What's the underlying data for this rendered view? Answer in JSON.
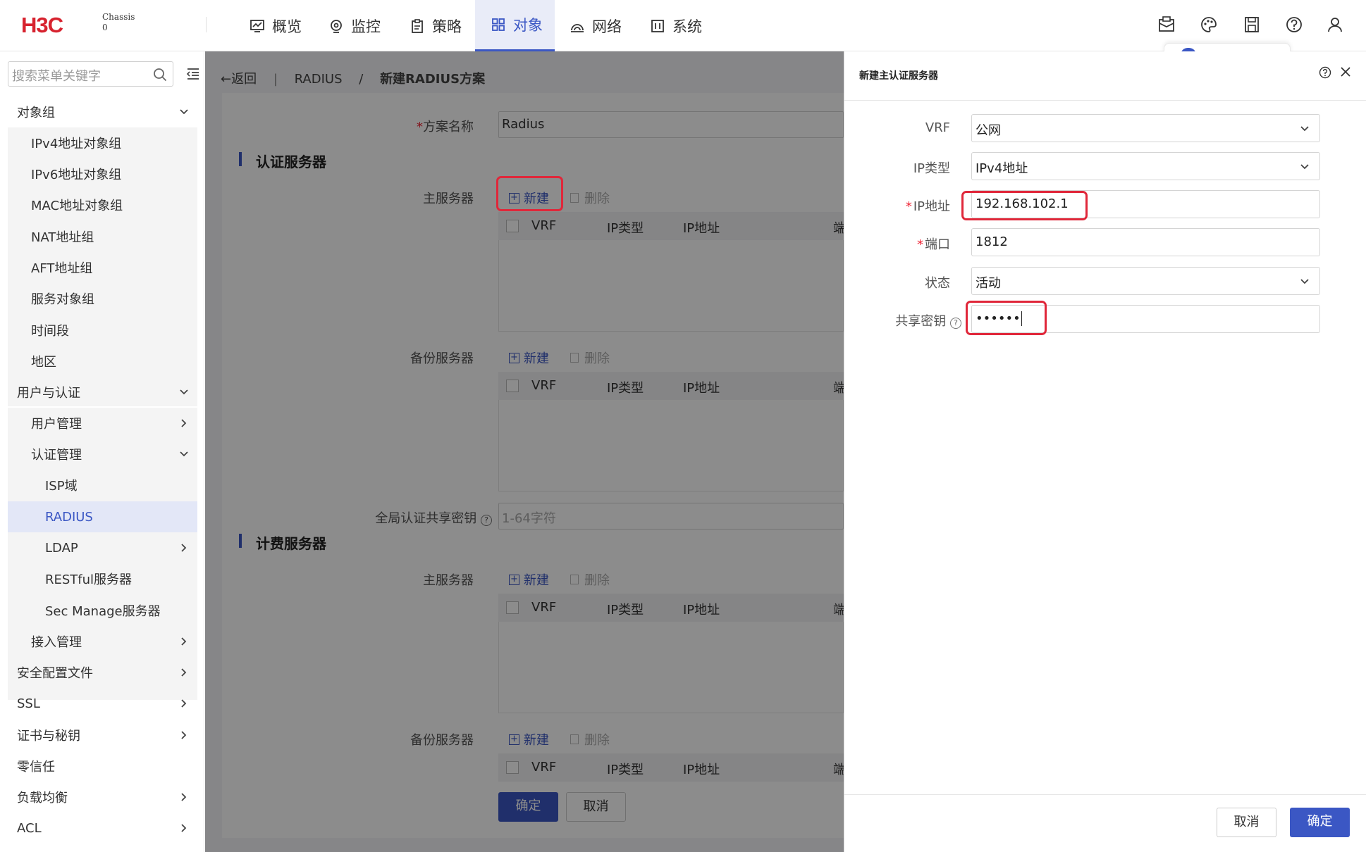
{
  "brand": {
    "logo": "H3C",
    "device_line1": "Chassis",
    "device_line2": "0"
  },
  "nav": [
    {
      "label": "概览",
      "icon": "dashboard-icon"
    },
    {
      "label": "监控",
      "icon": "monitor-icon"
    },
    {
      "label": "策略",
      "icon": "policy-icon"
    },
    {
      "label": "对象",
      "icon": "objects-icon",
      "active": true
    },
    {
      "label": "网络",
      "icon": "network-icon"
    },
    {
      "label": "系统",
      "icon": "system-icon"
    }
  ],
  "sidebar": {
    "search_placeholder": "搜索菜单关键字",
    "groups": {
      "object_group": "对象组",
      "ipv4": "IPv4地址对象组",
      "ipv6": "IPv6地址对象组",
      "mac": "MAC地址对象组",
      "nat": "NAT地址组",
      "aft": "AFT地址组",
      "service": "服务对象组",
      "time": "时间段",
      "region": "地区",
      "user_auth": "用户与认证",
      "user_mgmt": "用户管理",
      "auth_mgmt": "认证管理",
      "isp": "ISP域",
      "radius": "RADIUS",
      "ldap": "LDAP",
      "restful": "RESTful服务器",
      "secmanage": "Sec Manage服务器",
      "access_mgmt": "接入管理",
      "sec_profile": "安全配置文件",
      "ssl": "SSL",
      "cert": "证书与秘钥",
      "zero_trust": "零信任",
      "lb": "负载均衡",
      "acl": "ACL"
    }
  },
  "breadcrumb": {
    "back": "返回",
    "sep1": "|",
    "parent": "RADIUS",
    "sep2": "/",
    "current": "新建RADIUS方案"
  },
  "form": {
    "scheme_name_label": "方案名称",
    "scheme_name_value": "Radius",
    "auth_section": "认证服务器",
    "acct_section": "计费服务器",
    "primary_label": "主服务器",
    "backup_label": "备份服务器",
    "new_label": "新建",
    "delete_label": "删除",
    "col_vrf": "VRF",
    "col_iptype": "IP类型",
    "col_ip": "IP地址",
    "col_port_partial": "端",
    "global_key_label": "全局认证共享密钥",
    "global_key_placeholder": "1-64字符",
    "ok": "确定",
    "cancel": "取消"
  },
  "drawer": {
    "title": "新建主认证服务器",
    "vrf_label": "VRF",
    "vrf_value": "公网",
    "iptype_label": "IP类型",
    "iptype_value": "IPv4地址",
    "ip_label": "IP地址",
    "ip_value": "192.168.102.1",
    "port_label": "端口",
    "port_value": "1812",
    "state_label": "状态",
    "state_value": "活动",
    "key_label": "共享密钥",
    "key_value": "••••••",
    "cancel": "取消",
    "ok": "确定"
  },
  "colors": {
    "accent": "#3b57c4",
    "highlight": "#e0273a",
    "logo_red": "#d7232f"
  }
}
